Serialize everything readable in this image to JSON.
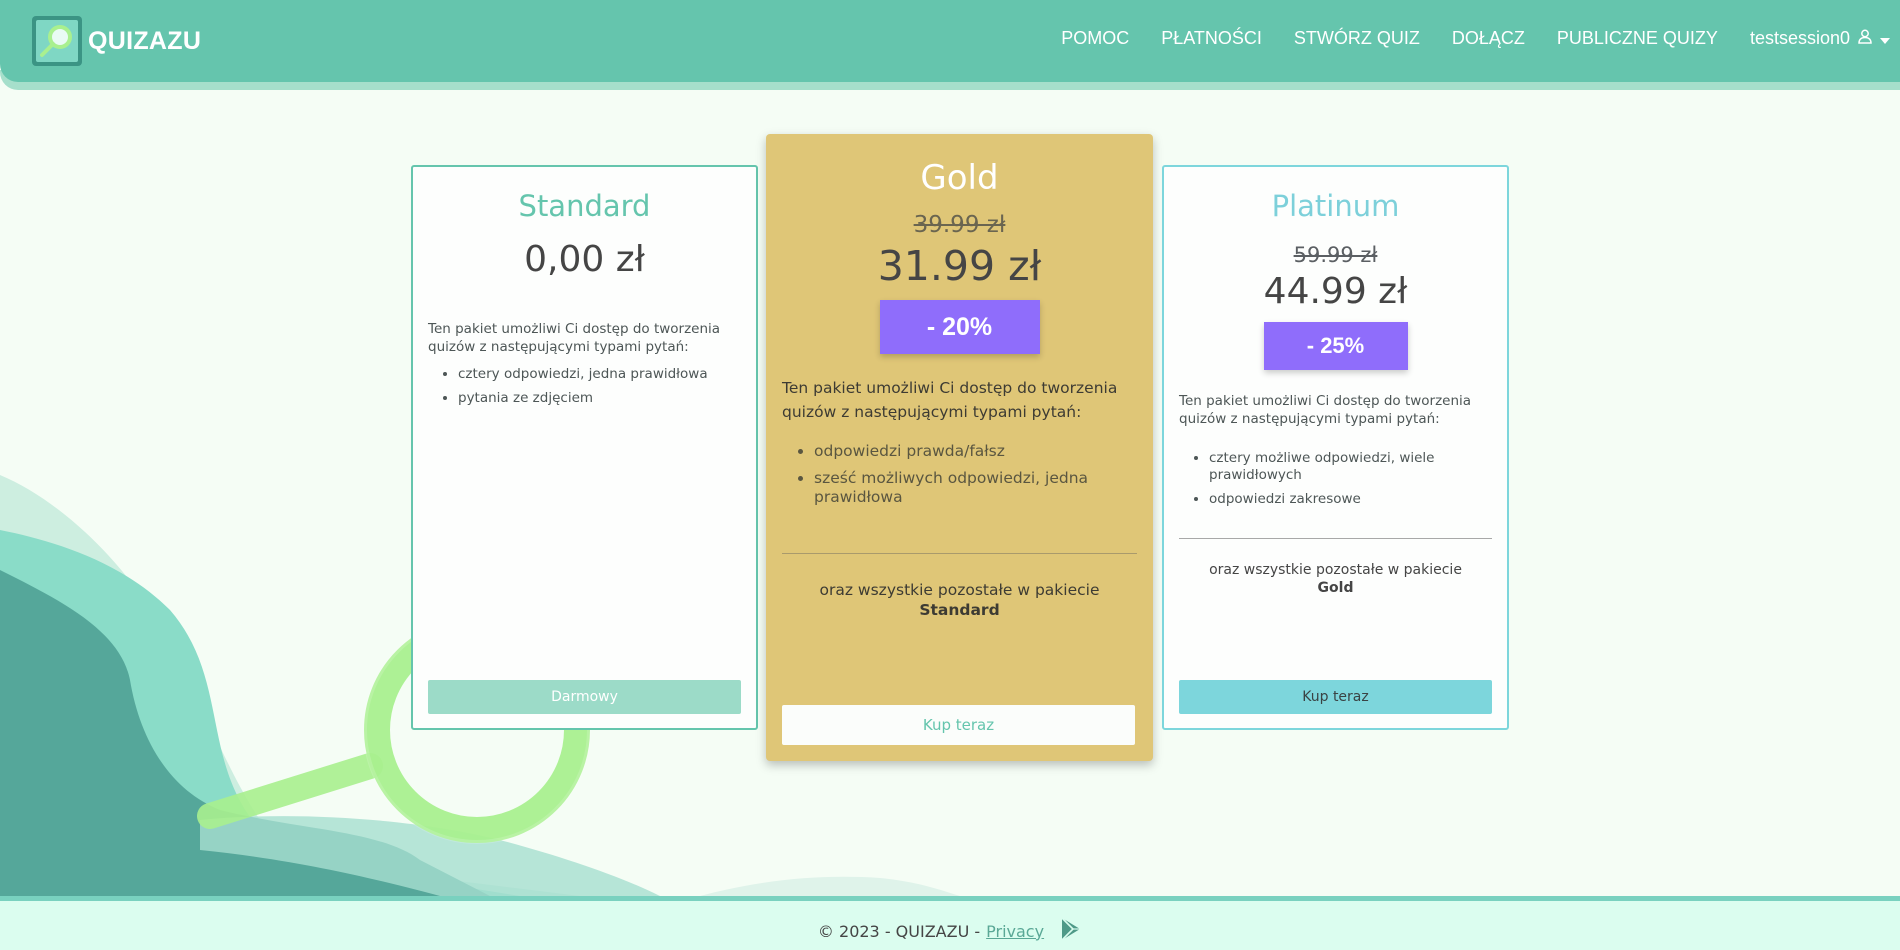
{
  "brand": {
    "name": "QUIZAZU"
  },
  "nav": {
    "items": [
      "POMOC",
      "PŁATNOŚCI",
      "STWÓRZ QUIZ",
      "DOŁĄCZ",
      "PUBLICZNE QUIZY"
    ],
    "user": "testsession0"
  },
  "plans": {
    "standard": {
      "title": "Standard",
      "price": "0,00 zł",
      "description": "Ten pakiet umożliwi Ci dostęp do tworzenia quizów z następującymi typami pytań:",
      "features": [
        "cztery odpowiedzi, jedna prawidłowa",
        "pytania ze zdjęciem"
      ],
      "button": "Darmowy"
    },
    "gold": {
      "title": "Gold",
      "old_price": "39.99 zł",
      "price": "31.99 zł",
      "discount": "- 20%",
      "description": "Ten pakiet umożliwi Ci dostęp do tworzenia quizów z następującymi typami pytań:",
      "features": [
        "odpowiedzi prawda/fałsz",
        "sześć możliwych odpowiedzi, jedna prawidłowa"
      ],
      "also": "oraz wszystkie pozostałe w pakiecie",
      "also_plan": "Standard",
      "button": "Kup teraz"
    },
    "platinum": {
      "title": "Platinum",
      "old_price": "59.99 zł",
      "price": "44.99 zł",
      "discount": "- 25%",
      "description": "Ten pakiet umożliwi Ci dostęp do tworzenia quizów z następującymi typami pytań:",
      "features": [
        "cztery możliwe odpowiedzi, wiele prawidłowych",
        "odpowiedzi zakresowe"
      ],
      "also": "oraz wszystkie pozostałe w pakiecie",
      "also_plan": "Gold",
      "button": "Kup teraz"
    }
  },
  "footer": {
    "copyright": "© 2023 - QUIZAZU -",
    "privacy": "Privacy"
  },
  "icons": {
    "user": "user-icon",
    "caret": "caret-down-icon",
    "logo": "magnifier-logo-icon",
    "store": "play-store-icon"
  },
  "colors": {
    "primary": "#65c5ad",
    "gold": "#dfc677",
    "platinum": "#7dd6dc",
    "discount": "#8f6dfb"
  }
}
